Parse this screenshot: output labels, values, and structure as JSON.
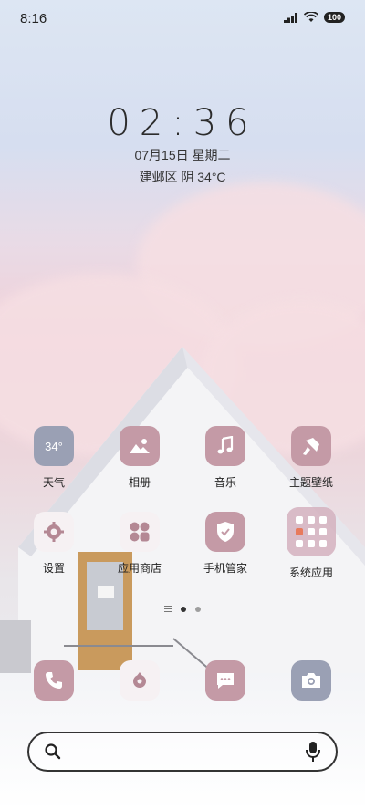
{
  "status_bar": {
    "time": "8:16",
    "battery": "100"
  },
  "clock": {
    "time": "02:36",
    "date": "07月15日 星期二",
    "weather": "建邺区 阴 34°C"
  },
  "apps": {
    "weather": {
      "label": "天气",
      "icon_text": "34°"
    },
    "gallery": {
      "label": "相册"
    },
    "music": {
      "label": "音乐"
    },
    "themes": {
      "label": "主题壁纸"
    },
    "settings": {
      "label": "设置"
    },
    "app_store": {
      "label": "应用商店"
    },
    "security": {
      "label": "手机管家"
    },
    "system_apps": {
      "label": "系统应用"
    }
  },
  "pager": {
    "total": 2,
    "active": 1
  },
  "colors": {
    "accent_pink": "#c49aa6",
    "slate": "#9aa0b4"
  },
  "icons": [
    "signal-icon",
    "wifi-icon",
    "battery-icon",
    "phone-icon",
    "browser-icon",
    "messages-icon",
    "camera-icon",
    "search-icon",
    "microphone-icon"
  ]
}
